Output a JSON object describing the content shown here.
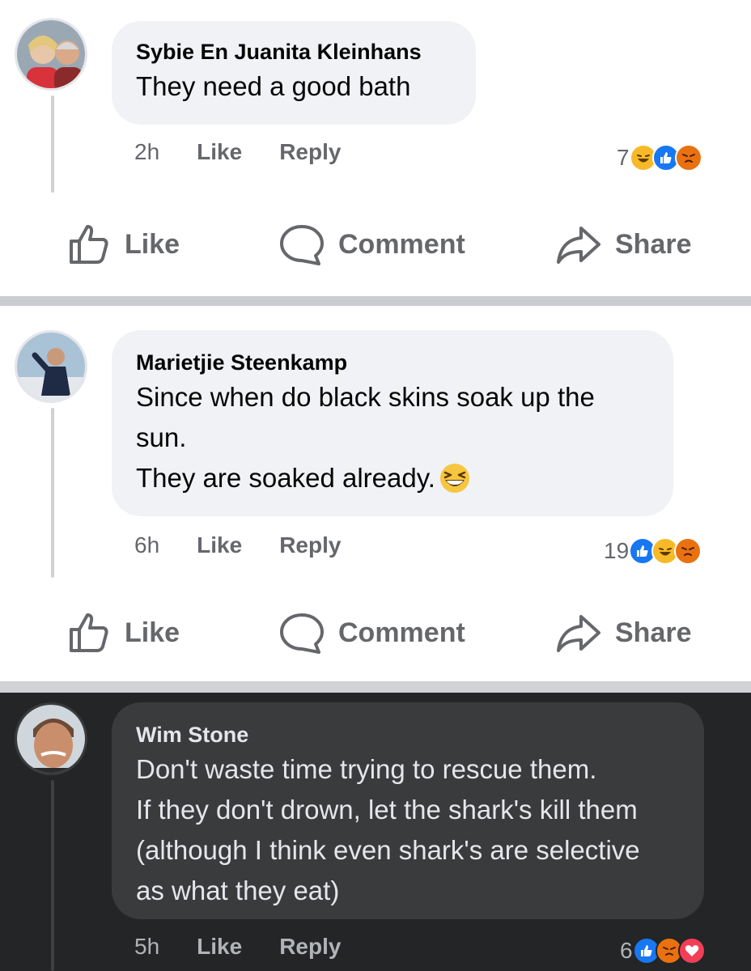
{
  "comments": [
    {
      "author": "Sybie En Juanita Kleinhans",
      "text_lines": [
        "They need a good bath"
      ],
      "time": "2h",
      "like_label": "Like",
      "reply_label": "Reply",
      "reaction_count": "7",
      "reactions": [
        "haha",
        "like",
        "angry"
      ]
    },
    {
      "author": "Marietjie Steenkamp",
      "text_lines": [
        "Since when do black skins soak up the",
        "sun.",
        "They are soaked already."
      ],
      "emoji": "grinning-squinting-face",
      "time": "6h",
      "like_label": "Like",
      "reply_label": "Reply",
      "reaction_count": "19",
      "reactions": [
        "like",
        "haha",
        "angry"
      ]
    },
    {
      "author": "Wim Stone",
      "text_lines": [
        "Don't waste time trying to rescue them.",
        "If they don't drown, let the shark's kill them",
        "(although I think even shark's are selective",
        "as what they eat)"
      ],
      "time": "5h",
      "like_label": "Like",
      "reply_label": "Reply",
      "reaction_count": "6",
      "reactions": [
        "like",
        "angry",
        "love"
      ]
    }
  ],
  "post_actions": {
    "like": "Like",
    "comment": "Comment",
    "share": "Share"
  },
  "colors": {
    "like_blue": "#1877f2",
    "haha_yellow": "#f7b928",
    "angry_orange": "#e9710f",
    "love_red": "#f33e58",
    "dark_bg": "#242526"
  }
}
